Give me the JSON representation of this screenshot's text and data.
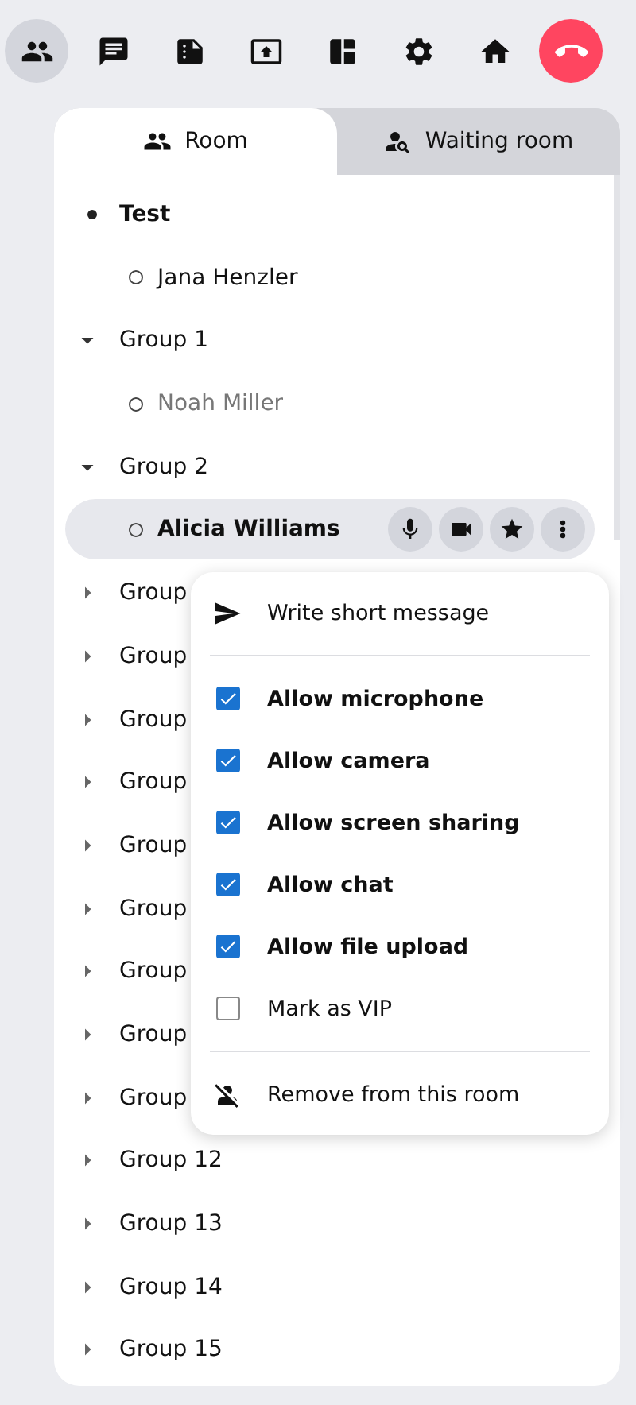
{
  "toolbar": [
    {
      "kind": "participants",
      "selected": true
    },
    {
      "kind": "chat",
      "selected": false
    },
    {
      "kind": "protocol",
      "selected": false
    },
    {
      "kind": "upload",
      "selected": false
    },
    {
      "kind": "apps",
      "selected": false
    },
    {
      "kind": "settings",
      "selected": false
    },
    {
      "kind": "home",
      "selected": false
    },
    {
      "kind": "hangup",
      "selected": false
    }
  ],
  "tabs": [
    {
      "label": "Room",
      "kind": "room",
      "selected": true
    },
    {
      "label": "Waiting room",
      "kind": "waiting",
      "selected": false
    }
  ],
  "tree": [
    {
      "kind": "room",
      "label": "Test",
      "children": [
        {
          "name": "Jana Henzler",
          "inactive": false,
          "selected": false
        }
      ]
    },
    {
      "kind": "group",
      "label": "Group 1",
      "expanded": true,
      "children": [
        {
          "name": "Noah Miller",
          "inactive": true,
          "selected": false
        }
      ]
    },
    {
      "kind": "group",
      "label": "Group 2",
      "expanded": true,
      "children": [
        {
          "name": "Alicia Williams",
          "inactive": false,
          "selected": true
        }
      ]
    },
    {
      "kind": "group",
      "label": "Group",
      "expanded": false
    },
    {
      "kind": "group",
      "label": "Group",
      "expanded": false
    },
    {
      "kind": "group",
      "label": "Group",
      "expanded": false
    },
    {
      "kind": "group",
      "label": "Group",
      "expanded": false
    },
    {
      "kind": "group",
      "label": "Group",
      "expanded": false
    },
    {
      "kind": "group",
      "label": "Group",
      "expanded": false
    },
    {
      "kind": "group",
      "label": "Group",
      "expanded": false
    },
    {
      "kind": "group",
      "label": "Group",
      "expanded": false
    },
    {
      "kind": "group",
      "label": "Group",
      "expanded": false
    },
    {
      "kind": "group",
      "label": "Group 12",
      "expanded": false
    },
    {
      "kind": "group",
      "label": "Group 13",
      "expanded": false
    },
    {
      "kind": "group",
      "label": "Group 14",
      "expanded": false
    },
    {
      "kind": "group",
      "label": "Group 15",
      "expanded": false
    }
  ],
  "context_menu": [
    {
      "kind": "message",
      "label": "Write short message"
    },
    {
      "kind": "divider"
    },
    {
      "kind": "checkbox",
      "label": "Allow microphone",
      "checked": true
    },
    {
      "kind": "checkbox",
      "label": "Allow camera",
      "checked": true
    },
    {
      "kind": "checkbox",
      "label": "Allow screen sharing",
      "checked": true
    },
    {
      "kind": "checkbox",
      "label": "Allow chat",
      "checked": true
    },
    {
      "kind": "checkbox",
      "label": "Allow file upload",
      "checked": true
    },
    {
      "kind": "checkbox",
      "label": "Mark as VIP",
      "checked": false
    },
    {
      "kind": "divider"
    },
    {
      "kind": "remove",
      "label": "Remove from this room"
    }
  ]
}
